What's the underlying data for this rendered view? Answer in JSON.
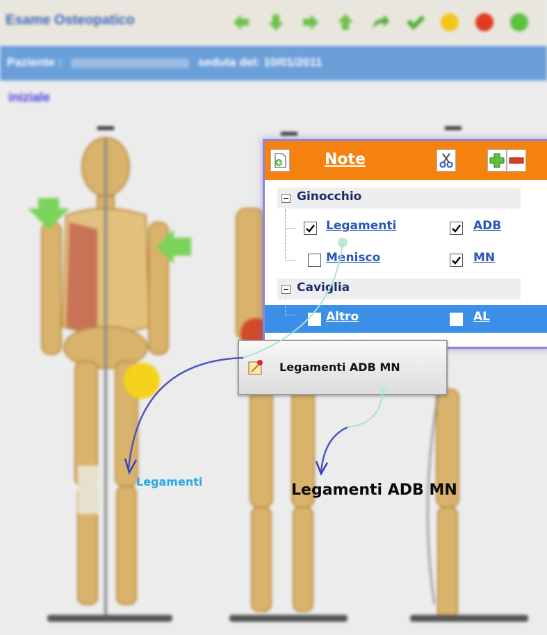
{
  "app": {
    "title": "Esame Osteopatico",
    "toolbar": [
      "arrow-left-icon",
      "arrow-down-icon",
      "arrow-right-icon",
      "arrow-up-icon",
      "redo-icon",
      "check-icon",
      "yellow-circle-icon",
      "red-circle-icon",
      "green-circle-icon"
    ]
  },
  "patient": {
    "label": "Paziente :",
    "session_label": "seduta del: 10/01/2011"
  },
  "section": "iniziale",
  "note": {
    "title": "Note",
    "groups": [
      {
        "label": "Ginocchio",
        "items": [
          {
            "label": "Legamenti",
            "checked": true,
            "code": "ADB",
            "code_checked": true
          },
          {
            "label": "Menisco",
            "checked": false,
            "code": "MN",
            "code_checked": true
          }
        ]
      },
      {
        "label": "Caviglia",
        "items": [
          {
            "label": "Altro",
            "checked": false,
            "code": "AL",
            "code_checked": false,
            "selected": true
          }
        ]
      }
    ]
  },
  "tooltip": {
    "text": "Legamenti ADB MN"
  },
  "callouts": {
    "small": "Legamenti",
    "large": "Legamenti ADB MN"
  },
  "colors": {
    "note_header": "#f5820f",
    "selection": "#3c8fe6",
    "link": "#2b56b8",
    "patient_bar": "#6a9fd8",
    "callout_small": "#2aa7e4"
  }
}
